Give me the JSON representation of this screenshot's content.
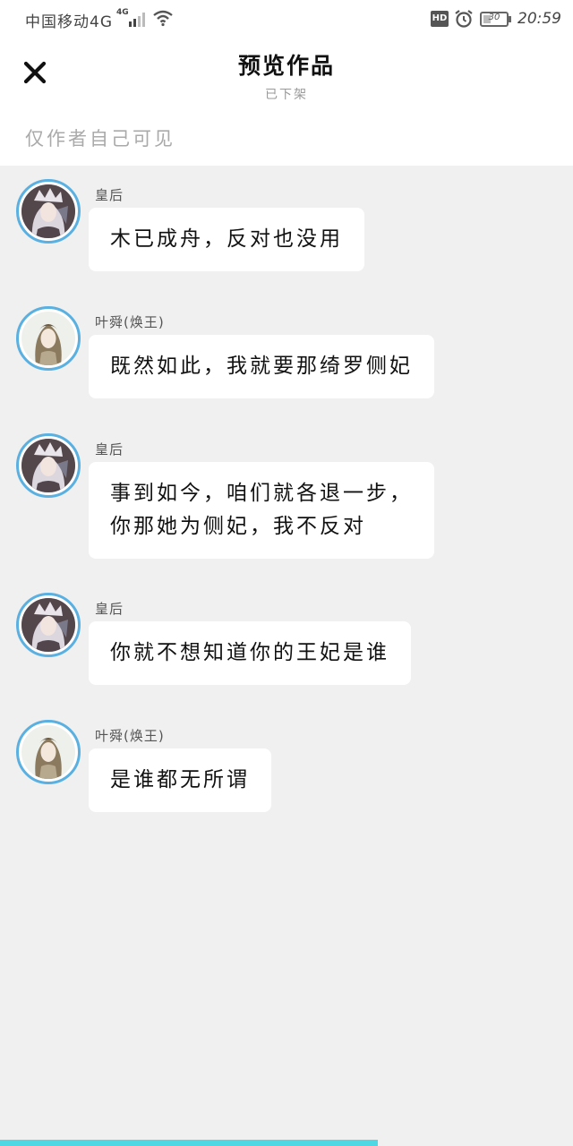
{
  "status_bar": {
    "carrier": "中国移动4G",
    "network_badge": "4G",
    "battery_level": "30",
    "time": "20:59",
    "hd_label": "HD"
  },
  "header": {
    "title": "预览作品",
    "subtitle": "已下架",
    "visibility_note": "仅作者自己可见"
  },
  "messages": [
    {
      "speaker": "皇后",
      "avatar": "queen-avatar",
      "lines": [
        "木已成舟，反对也没用"
      ]
    },
    {
      "speaker": "叶舜(焕王)",
      "avatar": "prince-avatar",
      "lines": [
        "既然如此，我就要那绮罗侧妃"
      ]
    },
    {
      "speaker": "皇后",
      "avatar": "queen-avatar",
      "lines": [
        "事到如今，咱们就各退一步，",
        "你那她为侧妃，我不反对"
      ]
    },
    {
      "speaker": "皇后",
      "avatar": "queen-avatar",
      "lines": [
        "你就不想知道你的王妃是谁"
      ]
    },
    {
      "speaker": "叶舜(焕王)",
      "avatar": "prince-avatar",
      "lines": [
        "是谁都无所谓"
      ]
    }
  ],
  "progress": 0.66,
  "colors": {
    "avatar_ring": "#5ab0e0",
    "progress": "#4fd8e4",
    "chat_background": "#f0f0f0"
  }
}
